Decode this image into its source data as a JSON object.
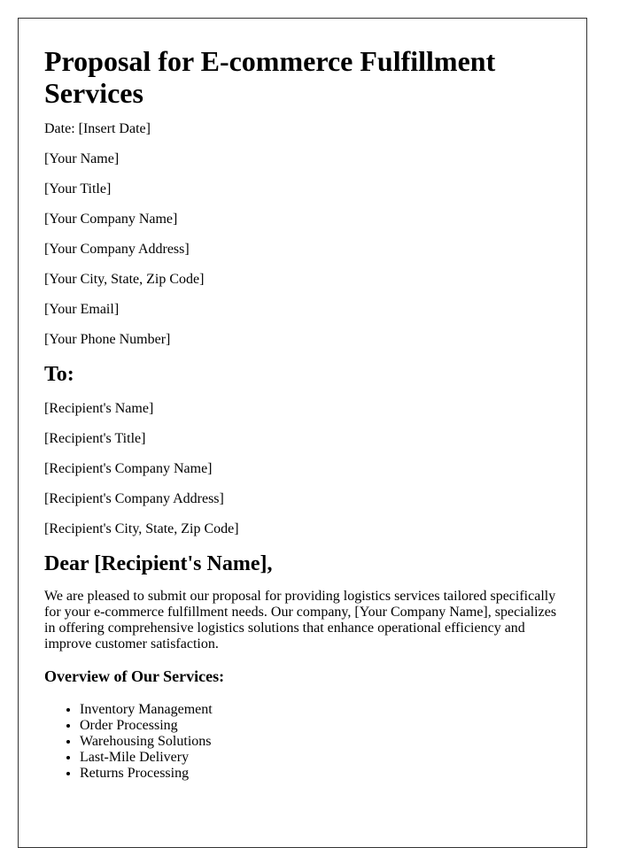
{
  "document": {
    "title": "Proposal for E-commerce Fulfillment Services",
    "date_line": "Date: [Insert Date]",
    "sender": {
      "name": "[Your Name]",
      "title": "[Your Title]",
      "company_name": "[Your Company Name]",
      "company_address": "[Your Company Address]",
      "city_state_zip": "[Your City, State, Zip Code]",
      "email": "[Your Email]",
      "phone": "[Your Phone Number]"
    },
    "to_heading": "To:",
    "recipient": {
      "name": "[Recipient's Name]",
      "title": "[Recipient's Title]",
      "company_name": "[Recipient's Company Name]",
      "company_address": "[Recipient's Company Address]",
      "city_state_zip": "[Recipient's City, State, Zip Code]"
    },
    "salutation": "Dear [Recipient's Name],",
    "intro_paragraph": "We are pleased to submit our proposal for providing logistics services tailored specifically for your e-commerce fulfillment needs. Our company, [Your Company Name], specializes in offering comprehensive logistics solutions that enhance operational efficiency and improve customer satisfaction.",
    "services_heading": "Overview of Our Services:",
    "services": [
      "Inventory Management",
      "Order Processing",
      "Warehousing Solutions",
      "Last-Mile Delivery",
      "Returns Processing"
    ]
  }
}
